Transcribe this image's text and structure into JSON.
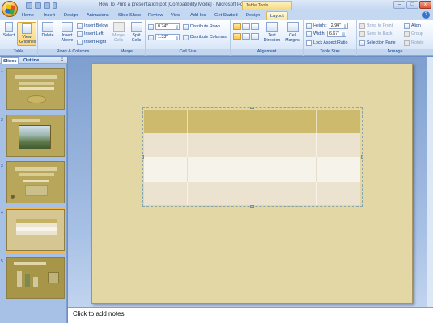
{
  "window": {
    "title": "How To Print a presentation.ppt [Compatibility Mode] - Microsoft PowerPoint",
    "contextual_tab_group": "Table Tools",
    "controls": {
      "minimize": "–",
      "maximize": "□",
      "close": "x"
    }
  },
  "tabs": [
    "Home",
    "Insert",
    "Design",
    "Animations",
    "Slide Show",
    "Review",
    "View",
    "Add-Ins",
    "Get Started",
    "Design",
    "Layout"
  ],
  "active_tab": "Layout",
  "ribbon": {
    "table": {
      "label": "Table",
      "select": "Select",
      "view_gridlines_1": "View",
      "view_gridlines_2": "Gridlines"
    },
    "rows_columns": {
      "label": "Rows & Columns",
      "delete": "Delete",
      "insert_above_1": "Insert",
      "insert_above_2": "Above",
      "insert_below": "Insert Below",
      "insert_left": "Insert Left",
      "insert_right": "Insert Right"
    },
    "merge": {
      "label": "Merge",
      "merge_cells_1": "Merge",
      "merge_cells_2": "Cells",
      "split_cells_1": "Split",
      "split_cells_2": "Cells"
    },
    "cell_size": {
      "label": "Cell Size",
      "height_value": "0.74\"",
      "width_value": "1.33\"",
      "distribute_rows": "Distribute Rows",
      "distribute_columns": "Distribute Columns"
    },
    "alignment": {
      "label": "Alignment",
      "text_direction_1": "Text",
      "text_direction_2": "Direction",
      "cell_margins_1": "Cell",
      "cell_margins_2": "Margins"
    },
    "table_size": {
      "label": "Table Size",
      "height_label": "Height:",
      "height_value": "2.94\"",
      "width_label": "Width:",
      "width_value": "6.67\"",
      "lock_aspect": "Lock Aspect Ratio"
    },
    "arrange": {
      "label": "Arrange",
      "bring_to_front": "Bring to Front",
      "send_to_back": "Send to Back",
      "selection_pane": "Selection Pane",
      "align": "Align",
      "group": "Group",
      "rotate": "Rotate"
    }
  },
  "left_pane": {
    "tabs": [
      "Slides",
      "Outline"
    ],
    "close": "x",
    "thumbnail_numbers": [
      "1",
      "2",
      "3",
      "4",
      "5"
    ],
    "selected_slide": "4"
  },
  "notes": {
    "placeholder": "Click to add notes"
  },
  "colors": {
    "slide_bg": "#e2d7a5",
    "table_header": "#cdba6c",
    "table_band1": "#ebe3cf",
    "table_band2": "#f6f3ea",
    "ribbon_blue": "#15428b",
    "active_tab": "#fbe7a2"
  }
}
